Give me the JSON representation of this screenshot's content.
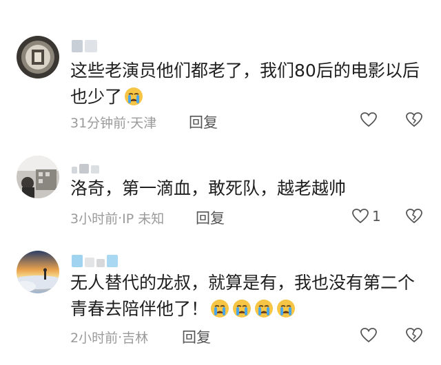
{
  "comments": [
    {
      "text": "这些老演员他们都老了，我们80后的电影以后也少了",
      "emoji_count": 1,
      "time": "31分钟前",
      "location": "天津",
      "reply_label": "回复",
      "like_count": ""
    },
    {
      "text": "洛奇，第一滴血，敢死队，越老越帅",
      "emoji_count": 0,
      "time": "3小时前",
      "location": "IP 未知",
      "reply_label": "回复",
      "like_count": "1"
    },
    {
      "text": "无人替代的龙叔，就算是有，我也没有第二个青春去陪伴他了！",
      "emoji_count": 4,
      "time": "2小时前",
      "location": "吉林",
      "reply_label": "回复",
      "like_count": ""
    }
  ],
  "separator": " · ",
  "icons": {
    "like": "heart-outline-icon",
    "dislike": "broken-heart-icon",
    "emoji": "crying-face-emoji"
  },
  "colors": {
    "meta": "#9a9a9a",
    "text": "#1e1e1e",
    "icon": "#555555"
  }
}
